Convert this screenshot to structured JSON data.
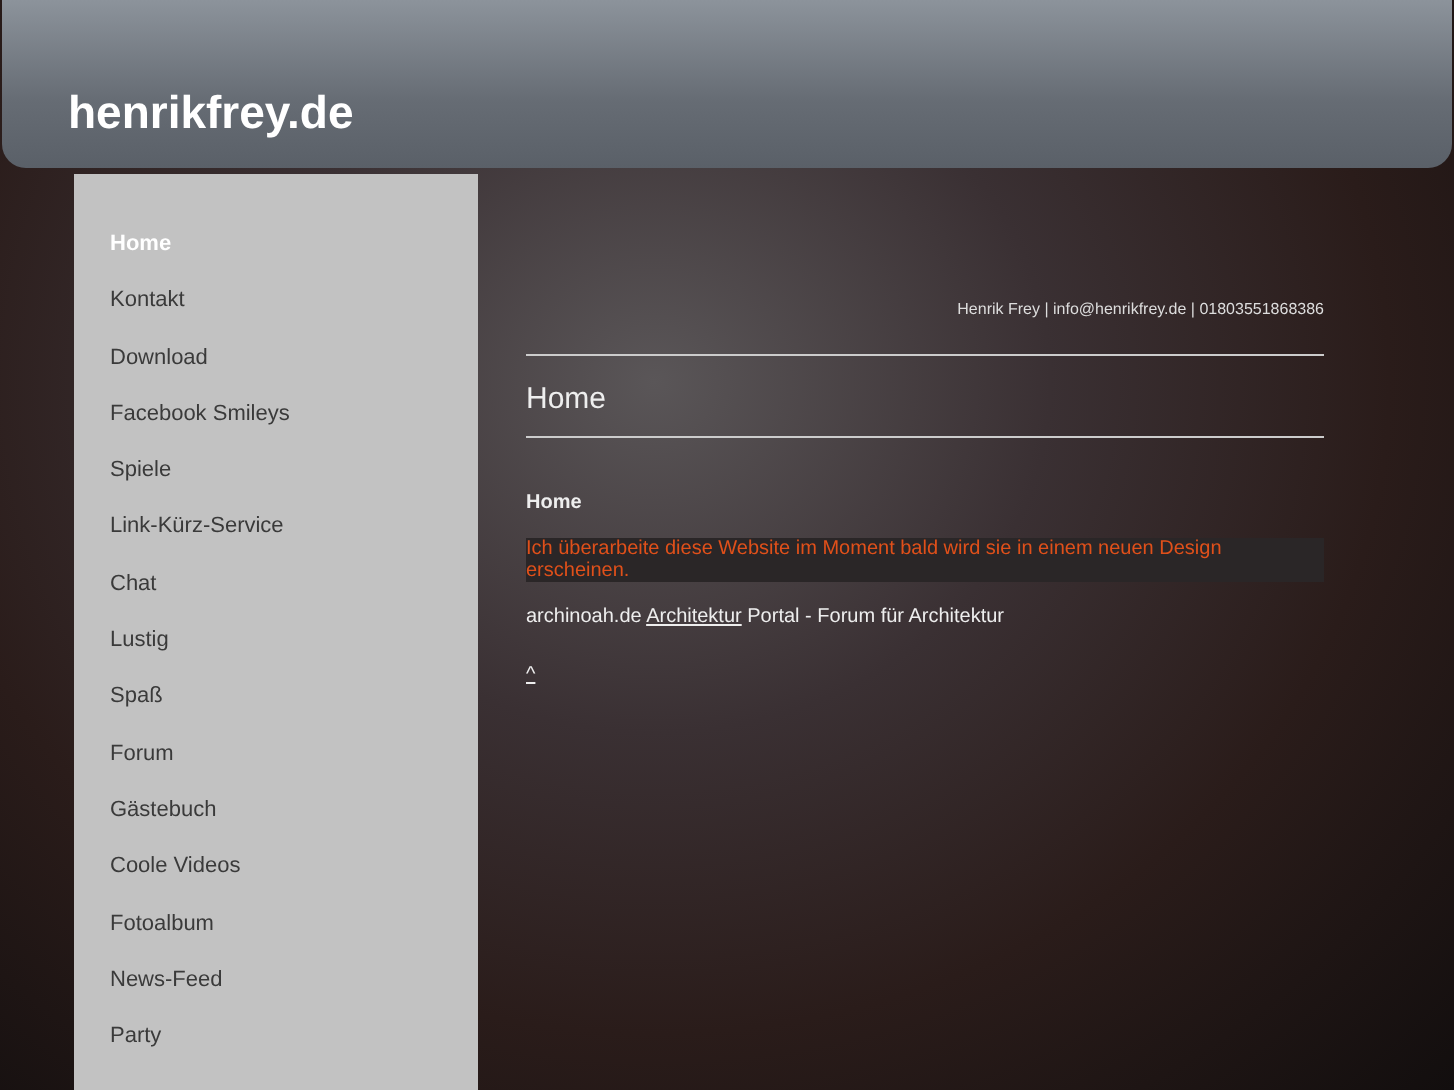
{
  "site_title": "henrikfrey.de",
  "nav": [
    {
      "label": "Home",
      "selected": true
    },
    {
      "label": "Kontakt",
      "selected": false
    },
    {
      "label": "Download",
      "selected": false
    },
    {
      "label": "Facebook Smileys",
      "selected": false
    },
    {
      "label": "Spiele",
      "selected": false
    },
    {
      "label": "Link-Kürz-Service",
      "selected": false
    },
    {
      "label": "Chat",
      "selected": false
    },
    {
      "label": "Lustig",
      "selected": false
    },
    {
      "label": "Spaß",
      "selected": false
    },
    {
      "label": "Forum",
      "selected": false
    },
    {
      "label": "Gästebuch",
      "selected": false
    },
    {
      "label": "Coole Videos",
      "selected": false
    },
    {
      "label": "Fotoalbum",
      "selected": false
    },
    {
      "label": "News-Feed",
      "selected": false
    },
    {
      "label": "Party",
      "selected": false
    }
  ],
  "contact_line": "Henrik Frey | info@henrikfrey.de | 01803551868386",
  "page_heading": "Home",
  "content": {
    "subheading": "Home",
    "notice": "Ich überarbeite diese Website im Moment bald wird sie in einem neuen Design erscheinen.",
    "links_line": {
      "before": "archinoah.de ",
      "link": "Architektur",
      "after": " Portal - Forum für Architektur"
    },
    "top_link": "^"
  }
}
